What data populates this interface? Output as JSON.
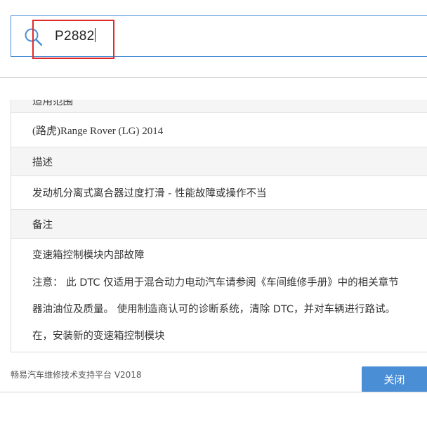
{
  "search": {
    "icon": "search-icon",
    "value": "P2882",
    "accent_color": "#4a8ed6",
    "highlight_color": "#e02a2a"
  },
  "details": {
    "scope_header": "适用范围",
    "scope_value": "(路虎)Range Rover (LG) 2014",
    "description_header": "描述",
    "description_value": "发动机分离式离合器过度打滑 - 性能故障或操作不当",
    "remarks_header": "备注",
    "remarks_lines": [
      "变速箱控制模块内部故障",
      "注意： 此 DTC 仅适用于混合动力电动汽车请参阅《车间维修手册》中的相关章节",
      "器油油位及质量。 使用制造商认可的诊断系统，清除 DTC，并对车辆进行路试。",
      "在，安装新的变速箱控制模块"
    ]
  },
  "footer": {
    "platform": "畅易汽车维修技术支持平台 V2018",
    "close_label": "关闭"
  }
}
